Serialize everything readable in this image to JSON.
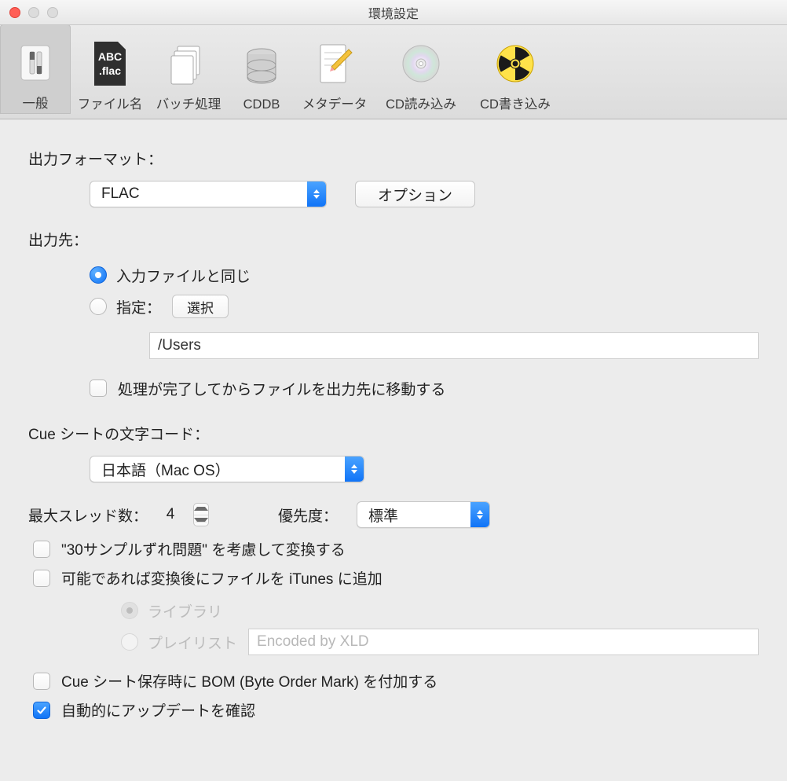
{
  "window": {
    "title": "環境設定"
  },
  "toolbar": {
    "items": [
      {
        "label": "一般"
      },
      {
        "label": "ファイル名"
      },
      {
        "label": "バッチ処理"
      },
      {
        "label": "CDDB"
      },
      {
        "label": "メタデータ"
      },
      {
        "label": "CD読み込み"
      },
      {
        "label": "CD書き込み"
      }
    ]
  },
  "labels": {
    "output_format": "出力フォーマット：",
    "option_btn": "オプション",
    "output_dest": "出力先：",
    "same_as_input": "入力ファイルと同じ",
    "specify": "指定：",
    "choose_btn": "選択",
    "path_value": "/Users",
    "move_after_done": "処理が完了してからファイルを出力先に移動する",
    "cue_encoding": "Cue シートの文字コード：",
    "max_threads": "最大スレッド数：",
    "priority": "優先度：",
    "chk_30sample": "\"30サンプルずれ問題\" を考慮して変換する",
    "chk_itunes": "可能であれば変換後にファイルを iTunes に追加",
    "radio_library": "ライブラリ",
    "radio_playlist": "プレイリスト",
    "playlist_placeholder": "Encoded by XLD",
    "chk_bom": "Cue シート保存時に BOM (Byte Order Mark) を付加する",
    "chk_autoupdate": "自動的にアップデートを確認"
  },
  "values": {
    "format": "FLAC",
    "cue_encoding": "日本語（Mac OS）",
    "threads": "4",
    "priority": "標準"
  }
}
